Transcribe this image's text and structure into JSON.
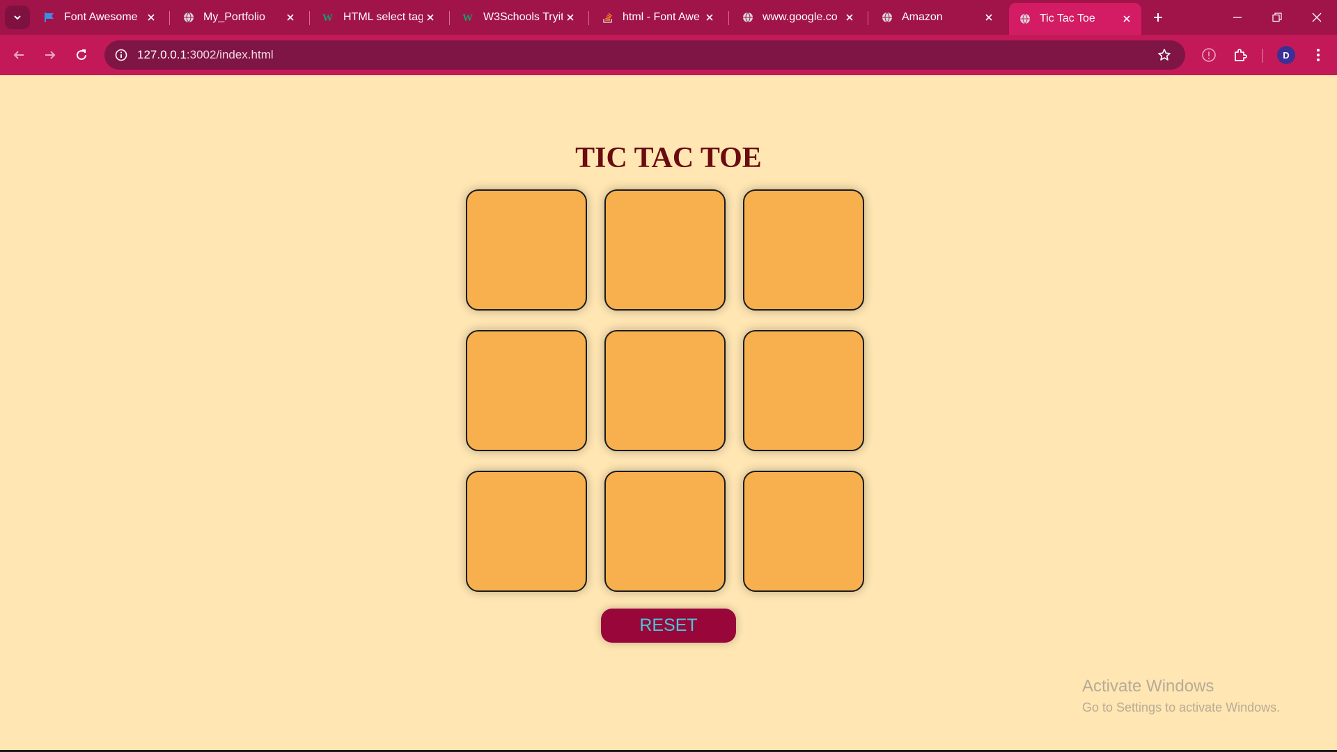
{
  "browser": {
    "tabs": [
      {
        "title": "Font Awesome",
        "icon": "flag-icon"
      },
      {
        "title": "My_Portfolio",
        "icon": "globe-icon"
      },
      {
        "title": "HTML select tag",
        "icon": "w3schools-icon"
      },
      {
        "title": "W3Schools Tryit",
        "icon": "w3schools-icon"
      },
      {
        "title": "html - Font Awe",
        "icon": "stackoverflow-icon"
      },
      {
        "title": "www.google.co",
        "icon": "globe-icon"
      },
      {
        "title": "Amazon",
        "icon": "globe-icon"
      },
      {
        "title": "Tic Tac Toe",
        "icon": "globe-icon",
        "active": true
      }
    ],
    "url_host": "127.0.0.1",
    "url_rest": ":3002/index.html",
    "profile_initial": "D"
  },
  "page": {
    "title": "TIC TAC TOE",
    "cells": [
      "",
      "",
      "",
      "",
      "",
      "",
      "",
      "",
      ""
    ],
    "reset_label": "RESET"
  },
  "watermark": {
    "line1": "Activate Windows",
    "line2": "Go to Settings to activate Windows."
  },
  "colors": {
    "page_background": "#ffe6b3",
    "cell_fill": "#f7b04d",
    "title_color": "#6b0a10",
    "reset_background": "#98063a",
    "reset_text": "#46c8dc",
    "browser_frame": "#a11449"
  }
}
